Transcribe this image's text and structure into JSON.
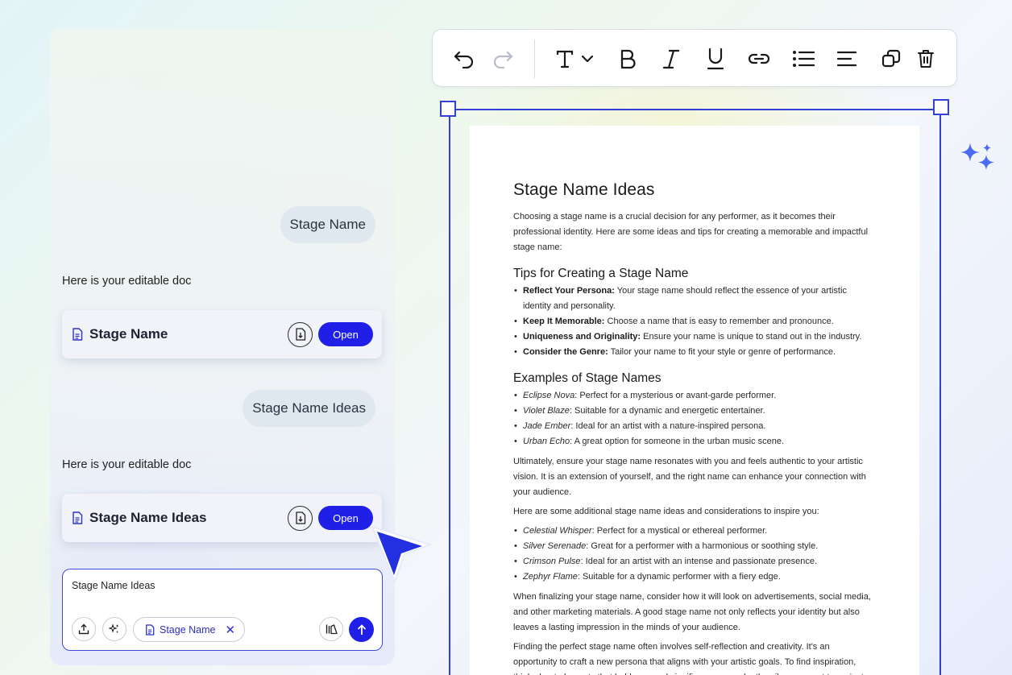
{
  "chat": {
    "messages": [
      {
        "role": "user",
        "text": "Stage Name"
      },
      {
        "role": "assistant",
        "text": "Here is your editable doc"
      },
      {
        "role": "user",
        "text": "Stage Name Ideas"
      },
      {
        "role": "assistant",
        "text": "Here is your editable doc"
      }
    ],
    "doc_cards": [
      {
        "title": "Stage Name",
        "open_label": "Open"
      },
      {
        "title": "Stage Name Ideas",
        "open_label": "Open"
      }
    ]
  },
  "composer": {
    "draft": "Stage Name Ideas",
    "attached_chip": "Stage Name"
  },
  "toolbar": {
    "buttons": [
      "undo-icon",
      "redo-icon",
      "text-style-icon",
      "bold-icon",
      "italic-icon",
      "underline-icon",
      "link-icon",
      "bulleted-list-icon",
      "align-left-icon",
      "duplicate-icon",
      "delete-icon"
    ]
  },
  "document": {
    "title": "Stage Name Ideas",
    "intro": "Choosing a stage name is a crucial decision for any performer, as it becomes their professional identity. Here are some ideas and tips for creating a memorable and impactful stage name:",
    "tips_heading": "Tips for Creating a Stage Name",
    "tips": [
      {
        "term": "Reflect Your Persona:",
        "text": " Your stage name should reflect the essence of your artistic identity and personality."
      },
      {
        "term": "Keep It Memorable:",
        "text": " Choose a name that is easy to remember and pronounce."
      },
      {
        "term": "Uniqueness and Originality:",
        "text": " Ensure your name is unique to stand out in the industry."
      },
      {
        "term": "Consider the Genre:",
        "text": " Tailor your name to fit your style or genre of performance."
      }
    ],
    "examples_heading": "Examples of Stage Names",
    "examples": [
      {
        "name": "Eclipse Nova",
        "text": ": Perfect for a mysterious or avant-garde performer."
      },
      {
        "name": "Violet Blaze",
        "text": ": Suitable for a dynamic and energetic entertainer."
      },
      {
        "name": "Jade Ember",
        "text": ": Ideal for an artist with a nature-inspired persona."
      },
      {
        "name": "Urban Echo",
        "text": ": A great option for someone in the urban music scene."
      }
    ],
    "para_ultimately": "Ultimately, ensure your stage name resonates with you and feels authentic to your artistic vision. It is an extension of yourself, and the right name can enhance your connection with your audience.",
    "para_additional": "Here are some additional stage name ideas and considerations to inspire you:",
    "more_examples": [
      {
        "name": "Celestial Whisper",
        "text": ": Perfect for a mystical or ethereal performer."
      },
      {
        "name": "Silver Serenade",
        "text": ": Great for a performer with a harmonious or soothing style."
      },
      {
        "name": "Crimson Pulse",
        "text": ": Ideal for an artist with an intense and passionate presence."
      },
      {
        "name": "Zephyr Flame",
        "text": ": Suitable for a dynamic performer with a fiery edge."
      }
    ],
    "para_finalizing": "When finalizing your stage name, consider how it will look on advertisements, social media, and other marketing materials. A good stage name not only reflects your identity but also leaves a lasting impression in the minds of your audience.",
    "para_finding": "Finding the perfect stage name often involves self-reflection and creativity. It's an opportunity to craft a new persona that aligns with your artistic goals. To find inspiration, think about elements that hold personal significance or evoke the vibe you want to project."
  },
  "colors": {
    "accent": "#1f1fe8",
    "frame": "#3240d6",
    "sparkle": "#4a6cf0"
  }
}
